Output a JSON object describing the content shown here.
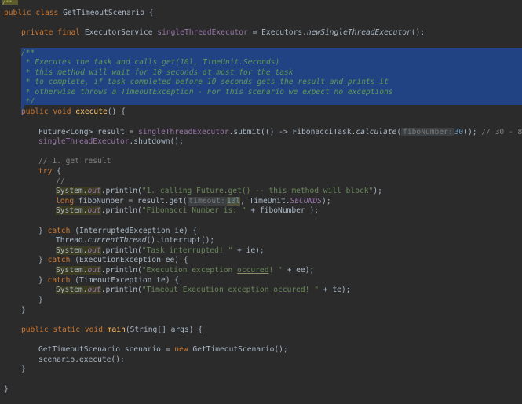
{
  "class_decl": {
    "kw": "public class ",
    "name": "GetTimeoutScenario",
    "brace": " {"
  },
  "field": {
    "kw": "private final ",
    "type": "ExecutorService ",
    "name": "singleThreadExecutor",
    "assign": " = Executors.",
    "call": "newSingleThreadExecutor",
    "end": "();"
  },
  "javadoc": [
    "/**",
    " * Executes the task and calls get(10l, TimeUnit.Seconds)",
    " * this method will wait for 10 seconds at most for the task",
    " * to complete, if task completed before 10 seconds gets the result and prints it",
    " * otherwise throws a TimeoutException - For this scenario we expect no exceptions",
    " */"
  ],
  "execute_decl": {
    "kw": "public void ",
    "name": "execute",
    "rest": "() {"
  },
  "future_line": {
    "a": "Future<Long> result = ",
    "field": "singleThreadExecutor",
    "b": ".submit(() -> FibonacciTask.",
    "call": "calculate",
    "c": "(",
    "hint": "fiboNumber:",
    "num": "30",
    "d": ")); ",
    "comment": "// 30 - 832040"
  },
  "shutdown_line": {
    "field": "singleThreadExecutor",
    "rest": ".shutdown();"
  },
  "comment_get": "// 1. get result",
  "try_kw": "try",
  "try_brace": " {",
  "empty_comment": "//",
  "sys": "System.",
  "out": "out",
  "println": ".println(",
  "msg_calling": "\"1. calling Future.get() -- this method will block\"",
  "close_call": ");",
  "fibo_line": {
    "kw": "long ",
    "a": "fiboNumber = result.get(",
    "hint": "timeout:",
    "num": "10l",
    "b": ", TimeUnit.",
    "st": "SECONDS",
    "c": ");"
  },
  "msg_fibo": "\"Fibonacci Number is: \"",
  "fibo_tail": " + fiboNumber );",
  "catch_kw": "catch",
  "catch_interrupted": " (InterruptedException ie) {",
  "thread_line": {
    "a": "Thread.",
    "call": "currentThread",
    "b": "().interrupt();"
  },
  "msg_interrupted": "\"Task interrupted! \"",
  "tail_ie": " + ie);",
  "catch_execution": " (ExecutionException ee) {",
  "msg_execution_a": "\"Execution exception ",
  "msg_occured": "occured",
  "msg_execution_b": "! \"",
  "tail_ee": " + ee);",
  "catch_timeout": " (TimeoutException te) {",
  "msg_timeout_a": "\"Timeout Execution exception ",
  "msg_timeout_b": "! \"",
  "tail_te": " + te);",
  "close_brace": "}",
  "catch_prefix": "} ",
  "main_decl": {
    "kw": "public static void ",
    "name": "main",
    "rest": "(String[] args) {"
  },
  "scenario_line": {
    "a": "GetTimeoutScenario scenario = ",
    "kw": "new ",
    "b": "GetTimeoutScenario();"
  },
  "exec_call": "scenario.execute();",
  "topmark": "/**"
}
